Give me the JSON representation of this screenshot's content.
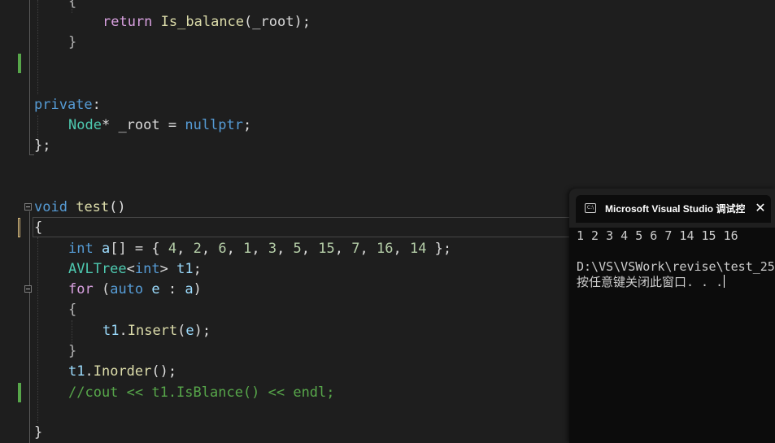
{
  "editor": {
    "lines": [
      {
        "id": "l0",
        "parts": [
          "{"
        ]
      },
      {
        "id": "l1",
        "parts": [
          "return",
          " ",
          "Is_balance",
          "(",
          "_root",
          ");"
        ]
      },
      {
        "id": "l2",
        "parts": [
          "}"
        ]
      },
      {
        "id": "l3",
        "parts": [
          "private",
          ":"
        ]
      },
      {
        "id": "l4",
        "parts": [
          "Node",
          "* ",
          "_root",
          " = ",
          "nullptr",
          ";"
        ]
      },
      {
        "id": "l5",
        "parts": [
          "};"
        ]
      },
      {
        "id": "l6",
        "parts": [
          "void",
          " ",
          "test",
          "()"
        ]
      },
      {
        "id": "l7",
        "parts": [
          "{"
        ]
      },
      {
        "id": "l8",
        "parts": [
          "int",
          " ",
          "a",
          "[] = { ",
          "4",
          ", ",
          "2",
          ", ",
          "6",
          ", ",
          "1",
          ", ",
          "3",
          ", ",
          "5",
          ", ",
          "15",
          ", ",
          "7",
          ", ",
          "16",
          ", ",
          "14",
          " };"
        ]
      },
      {
        "id": "l9",
        "parts": [
          "AVLTree",
          "<",
          "int",
          "> ",
          "t1",
          ";"
        ]
      },
      {
        "id": "l10",
        "parts": [
          "for",
          " (",
          "auto",
          " ",
          "e",
          " : ",
          "a",
          ")"
        ]
      },
      {
        "id": "l11",
        "parts": [
          "{"
        ]
      },
      {
        "id": "l12",
        "parts": [
          "t1",
          ".",
          "Insert",
          "(",
          "e",
          ");"
        ]
      },
      {
        "id": "l13",
        "parts": [
          "}"
        ]
      },
      {
        "id": "l14",
        "parts": [
          "t1",
          ".",
          "Inorder",
          "();"
        ]
      },
      {
        "id": "l15",
        "parts": [
          "//cout << t1.IsBlance() << endl;"
        ]
      },
      {
        "id": "l16",
        "parts": [
          "}"
        ]
      }
    ]
  },
  "console": {
    "title": "Microsoft Visual Studio 调试控制台",
    "close_glyph": "✕",
    "icon_text": "C:\\",
    "output_line": "1 2 3 4 5 6 7 14 15 16",
    "path_line": "D:\\VS\\VSWork\\revise\\test_25",
    "prompt_line": "按任意键关闭此窗口. . ."
  },
  "colors": {
    "background": "#1e1e1e",
    "keyword": "#569cd6",
    "control_keyword": "#d8a0df",
    "function": "#dcdcaa",
    "type": "#4ec9b0",
    "number": "#b5cea8",
    "variable": "#9cdcfe",
    "comment": "#57a64a",
    "console_background": "#0c0c0c"
  }
}
